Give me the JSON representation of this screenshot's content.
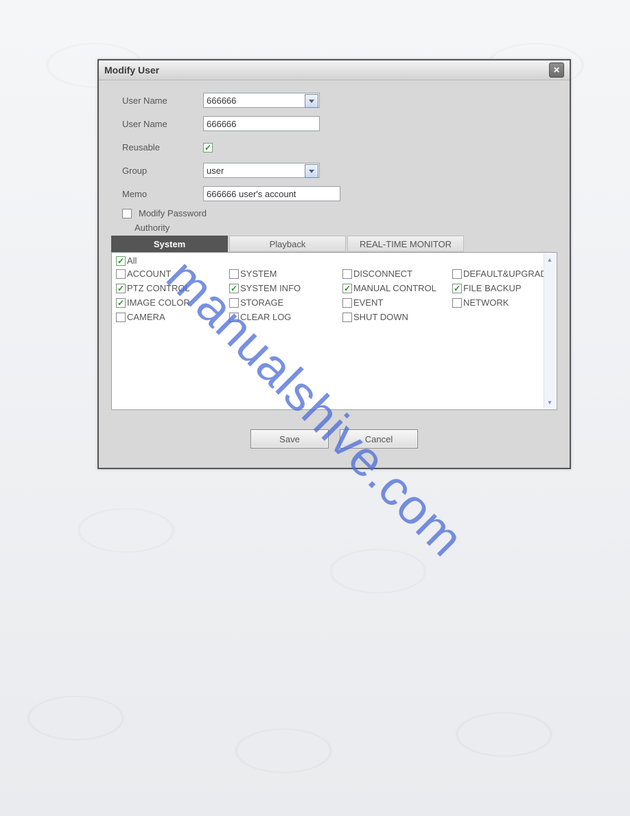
{
  "watermark_text": "manualshive.com",
  "dialog": {
    "title": "Modify User",
    "fields": {
      "username_select": {
        "label": "User Name",
        "value": "666666"
      },
      "username_text": {
        "label": "User Name",
        "value": "666666"
      },
      "reusable": {
        "label": "Reusable",
        "checked": true
      },
      "group": {
        "label": "Group",
        "value": "user"
      },
      "memo": {
        "label": "Memo",
        "value": "666666 user's account"
      },
      "modify_password": {
        "label": "Modify Password",
        "checked": false
      },
      "authority_label": "Authority"
    },
    "tabs": [
      {
        "label": "System",
        "active": true
      },
      {
        "label": "Playback",
        "active": false
      },
      {
        "label": "REAL-TIME MONITOR",
        "active": false
      }
    ],
    "authority": {
      "all": {
        "label": "All",
        "checked": true
      },
      "items": [
        {
          "label": "ACCOUNT",
          "checked": false
        },
        {
          "label": "SYSTEM",
          "checked": false
        },
        {
          "label": "DISCONNECT",
          "checked": false
        },
        {
          "label": "DEFAULT&UPGRADE",
          "checked": false
        },
        {
          "label": "PTZ CONTROL",
          "checked": true
        },
        {
          "label": "SYSTEM INFO",
          "checked": true
        },
        {
          "label": "MANUAL CONTROL",
          "checked": true
        },
        {
          "label": "FILE BACKUP",
          "checked": true
        },
        {
          "label": "IMAGE COLOR",
          "checked": true
        },
        {
          "label": "STORAGE",
          "checked": false
        },
        {
          "label": "EVENT",
          "checked": false
        },
        {
          "label": "NETWORK",
          "checked": false
        },
        {
          "label": "CAMERA",
          "checked": false
        },
        {
          "label": "CLEAR LOG",
          "checked": false
        },
        {
          "label": "SHUT DOWN",
          "checked": false
        }
      ]
    },
    "buttons": {
      "save": "Save",
      "cancel": "Cancel"
    }
  }
}
